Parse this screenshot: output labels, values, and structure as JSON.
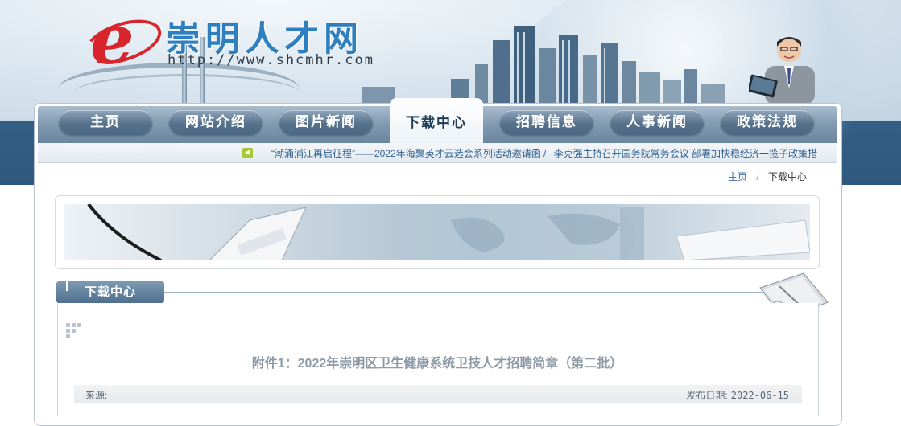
{
  "site": {
    "title": "崇明人才网",
    "url": "http://www.shcmhr.com"
  },
  "nav": {
    "items": [
      "主页",
      "网站介绍",
      "图片新闻",
      "下载中心",
      "招聘信息",
      "人事新闻",
      "政策法规"
    ],
    "active": "下载中心"
  },
  "ticker": {
    "items": [
      "“潮涌浦江再启征程”——2022年海聚英才云选会系列活动邀请函 /",
      "李克强主持召开国务院常务会议 部署加快稳经济一揽子政策措"
    ]
  },
  "breadcrumb": {
    "home": "主页",
    "separator": "/",
    "current": "下载中心"
  },
  "section": {
    "title": "下载中心"
  },
  "article": {
    "title": "附件1：2022年崇明区卫生健康系统卫技人才招聘简章（第二批）",
    "source_label": "来源:",
    "date_label": "发布日期:",
    "date": "2022-06-15"
  },
  "colors": {
    "brand_red": "#d9262c",
    "brand_blue": "#2f7fbf",
    "nav_bg": "#6b869e",
    "ticker_text": "#2e5f8f"
  }
}
